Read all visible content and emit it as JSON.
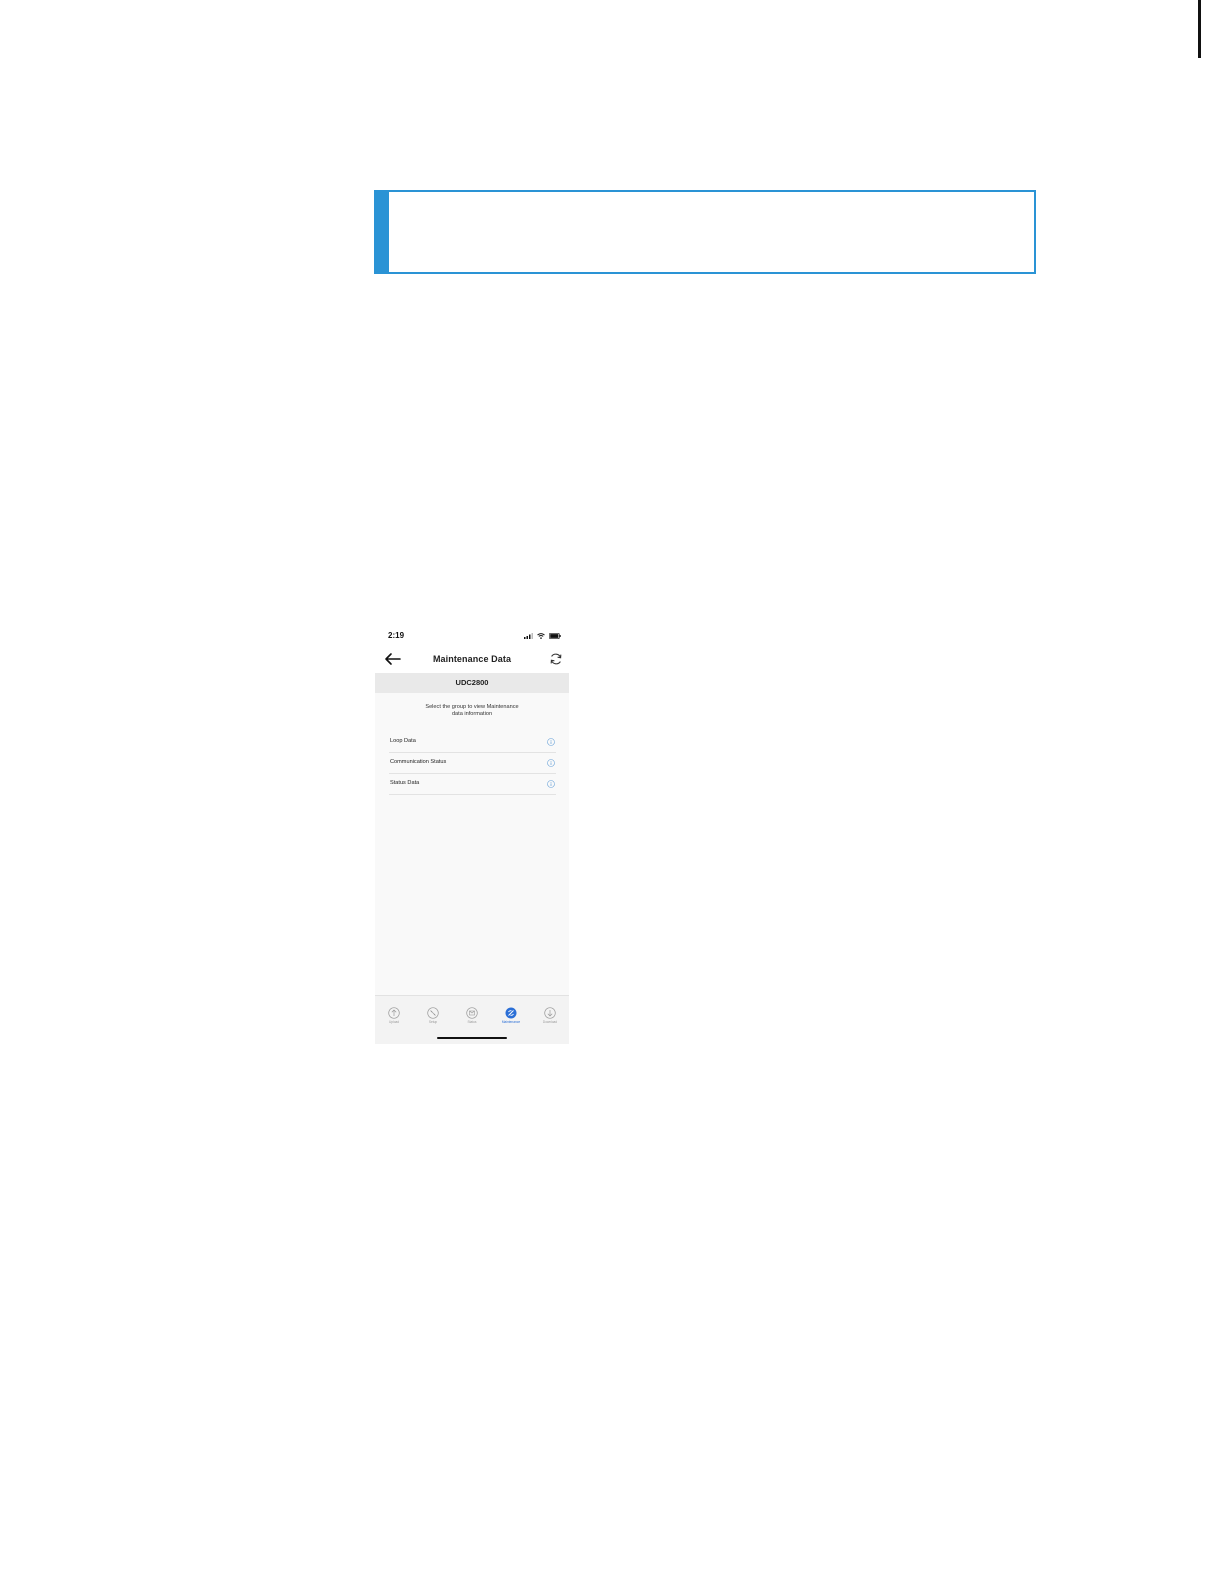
{
  "status_bar": {
    "time": "2:19"
  },
  "header": {
    "title": "Maintenance Data"
  },
  "device": {
    "name": "UDC2800"
  },
  "instruction": {
    "line1": "Select the group to view Maintenance",
    "line2": "data information"
  },
  "groups": [
    {
      "label": "Loop Data"
    },
    {
      "label": "Communication Status"
    },
    {
      "label": "Status Data"
    }
  ],
  "tabs": [
    {
      "label": "Upload",
      "icon": "upload-icon"
    },
    {
      "label": "Setup",
      "icon": "setup-icon"
    },
    {
      "label": "Status",
      "icon": "status-icon"
    },
    {
      "label": "Maintenance",
      "icon": "maintenance-icon",
      "active": true
    },
    {
      "label": "Download",
      "icon": "download-icon"
    }
  ],
  "colors": {
    "accent": "#2a93d5",
    "active_tab": "#2b6fd6"
  }
}
